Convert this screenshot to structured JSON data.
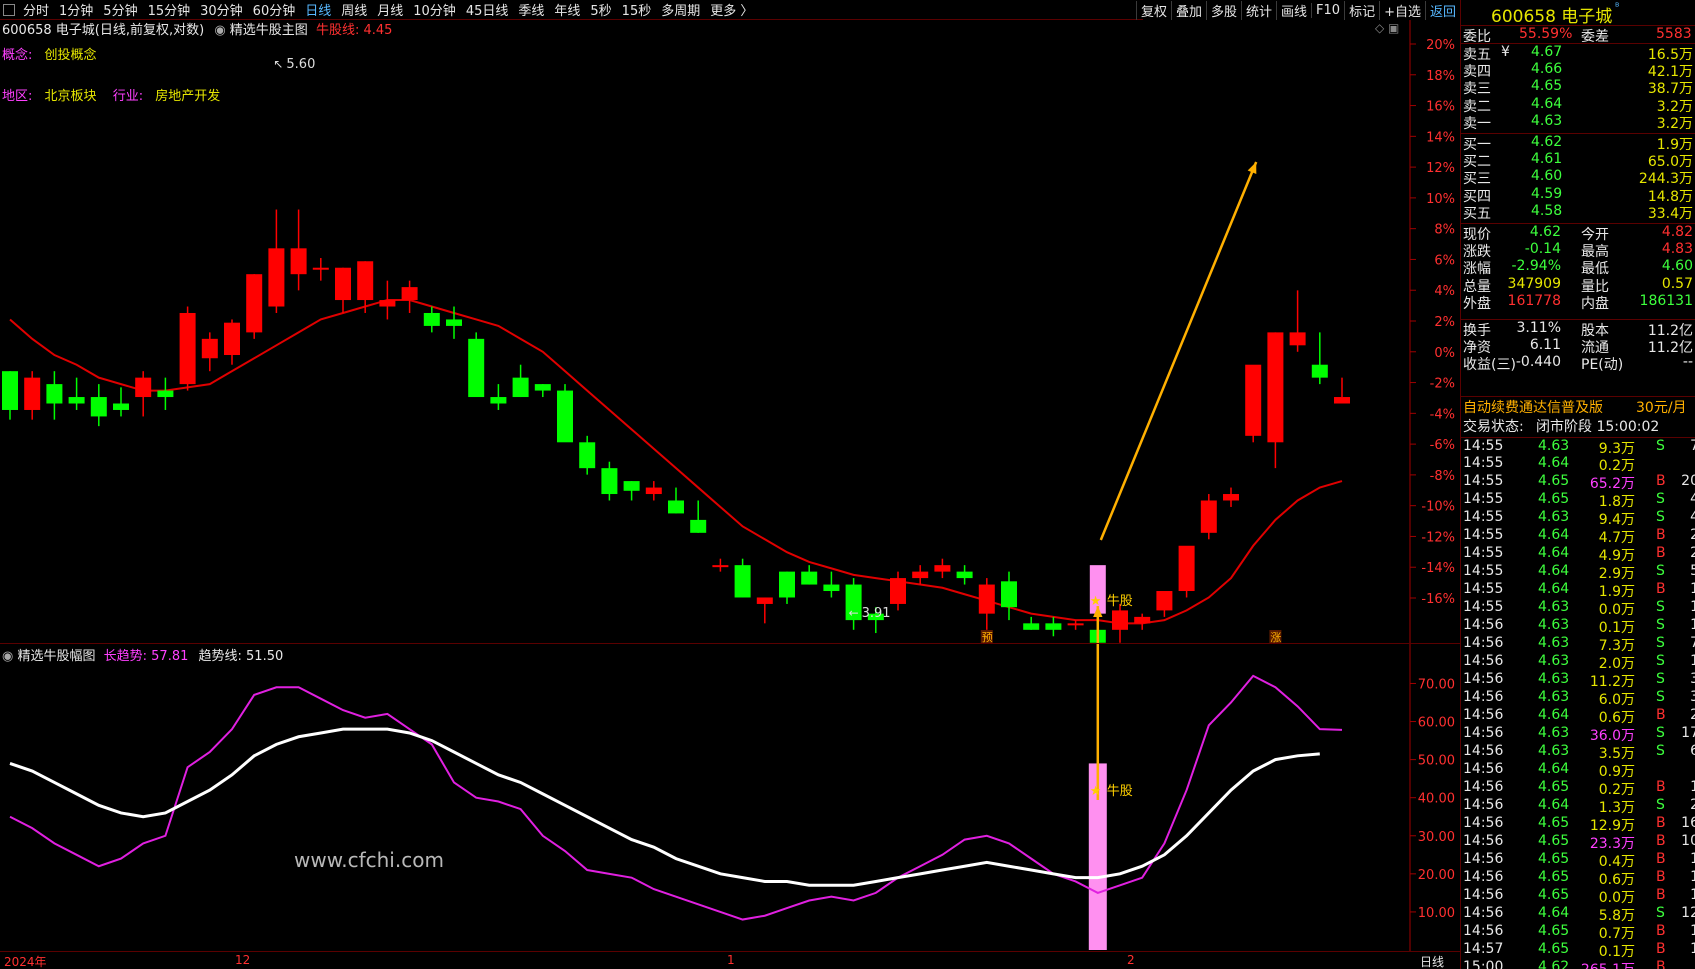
{
  "toolbar": {
    "periods": [
      "分时",
      "1分钟",
      "5分钟",
      "15分钟",
      "30分钟",
      "60分钟",
      "日线",
      "周线",
      "月线",
      "10分钟",
      "45日线",
      "季线",
      "年线",
      "5秒",
      "15秒",
      "多周期",
      "更多 〉"
    ],
    "active": "日线",
    "right": [
      "复权",
      "叠加",
      "多股",
      "统计",
      "画线",
      "F10",
      "标记",
      "+自选",
      "返回"
    ]
  },
  "main_header": {
    "stock": "600658 电子城(日线,前复权,对数)",
    "indicator": "精选牛股主图",
    "niu_line": "牛股线: 4.45"
  },
  "concept": {
    "label": "概念:",
    "value": "创投概念"
  },
  "region": {
    "label": "地区:",
    "value": "北京板块",
    "industry_label": "行业:",
    "industry_value": "房地产开发"
  },
  "price_labels": {
    "high": "5.60",
    "low": "3.91",
    "niu1": "牛股",
    "niu2": "牛股",
    "mark_yu": "预",
    "mark_zhang": "涨"
  },
  "y_axis_main": [
    "20%",
    "18%",
    "16%",
    "14%",
    "12%",
    "10%",
    "8%",
    "6%",
    "4%",
    "2%",
    "0%",
    "-2%",
    "-4%",
    "-6%",
    "-8%",
    "-10%",
    "-12%",
    "-14%",
    "-16%"
  ],
  "sub_header": {
    "name": "精选牛股幅图",
    "long_trend": "长趋势: 57.81",
    "trend_line": "趋势线: 51.50"
  },
  "y_axis_sub": [
    "70.00",
    "60.00",
    "50.00",
    "40.00",
    "30.00",
    "20.00",
    "10.00"
  ],
  "watermark": "www.cfchi.com",
  "x_axis": {
    "labels": [
      "2024年",
      "12",
      "1",
      "2"
    ],
    "period": "日线"
  },
  "colors": {
    "up": "#ff0000",
    "down": "#00ff00",
    "ma": "#e00000",
    "long_trend": "#e020e0",
    "trend": "#ffffff",
    "niu_bar": "#ff90f0",
    "arrow": "#ffb000"
  },
  "chart_data": {
    "type": "candlestick",
    "candles": [
      [
        4.7,
        4.7,
        4.55,
        4.58
      ],
      [
        4.58,
        4.7,
        4.55,
        4.68
      ],
      [
        4.66,
        4.7,
        4.55,
        4.6
      ],
      [
        4.62,
        4.68,
        4.58,
        4.6
      ],
      [
        4.62,
        4.66,
        4.53,
        4.56
      ],
      [
        4.6,
        4.65,
        4.56,
        4.58
      ],
      [
        4.62,
        4.7,
        4.56,
        4.68
      ],
      [
        4.64,
        4.68,
        4.58,
        4.62
      ],
      [
        4.66,
        4.9,
        4.64,
        4.88
      ],
      [
        4.74,
        4.82,
        4.7,
        4.8
      ],
      [
        4.75,
        4.86,
        4.72,
        4.85
      ],
      [
        4.82,
        5.0,
        4.8,
        5.0
      ],
      [
        4.9,
        5.2,
        4.88,
        5.08
      ],
      [
        5.0,
        5.2,
        4.95,
        5.08
      ],
      [
        5.02,
        5.05,
        4.98,
        5.02
      ],
      [
        4.92,
        5.02,
        4.88,
        5.02
      ],
      [
        4.92,
        5.04,
        4.88,
        5.04
      ],
      [
        4.9,
        4.98,
        4.86,
        4.92
      ],
      [
        4.92,
        4.98,
        4.88,
        4.96
      ],
      [
        4.88,
        4.9,
        4.82,
        4.84
      ],
      [
        4.86,
        4.9,
        4.8,
        4.84
      ],
      [
        4.8,
        4.82,
        4.64,
        4.62
      ],
      [
        4.62,
        4.66,
        4.58,
        4.6
      ],
      [
        4.68,
        4.72,
        4.62,
        4.62
      ],
      [
        4.66,
        4.66,
        4.62,
        4.64
      ],
      [
        4.64,
        4.66,
        4.5,
        4.48
      ],
      [
        4.48,
        4.5,
        4.38,
        4.4
      ],
      [
        4.4,
        4.42,
        4.3,
        4.32
      ],
      [
        4.36,
        4.36,
        4.3,
        4.33
      ],
      [
        4.32,
        4.36,
        4.3,
        4.34
      ],
      [
        4.3,
        4.34,
        4.26,
        4.26
      ],
      [
        4.24,
        4.3,
        4.2,
        4.2
      ],
      [
        4.1,
        4.12,
        4.08,
        4.1
      ],
      [
        4.1,
        4.12,
        4.0,
        4.0
      ],
      [
        3.98,
        4.0,
        3.92,
        4.0
      ],
      [
        4.08,
        4.08,
        3.98,
        4.0
      ],
      [
        4.08,
        4.1,
        4.04,
        4.04
      ],
      [
        4.04,
        4.08,
        4.0,
        4.02
      ],
      [
        4.04,
        4.06,
        3.9,
        3.93
      ],
      [
        3.95,
        3.97,
        3.89,
        3.93
      ],
      [
        3.98,
        4.08,
        3.96,
        4.06
      ],
      [
        4.06,
        4.1,
        4.04,
        4.08
      ],
      [
        4.08,
        4.12,
        4.06,
        4.1
      ],
      [
        4.08,
        4.1,
        4.04,
        4.06
      ],
      [
        3.95,
        4.06,
        3.9,
        4.04
      ],
      [
        4.05,
        4.08,
        3.93,
        3.97
      ],
      [
        3.92,
        3.94,
        3.9,
        3.9
      ],
      [
        3.92,
        3.94,
        3.88,
        3.9
      ],
      [
        3.92,
        3.93,
        3.9,
        3.92
      ],
      [
        3.9,
        3.92,
        3.84,
        3.86
      ],
      [
        3.9,
        3.98,
        3.86,
        3.96
      ],
      [
        3.92,
        3.95,
        3.9,
        3.94
      ],
      [
        3.96,
        4.0,
        3.94,
        4.02
      ],
      [
        4.02,
        4.14,
        4.0,
        4.16
      ],
      [
        4.2,
        4.32,
        4.18,
        4.3
      ],
      [
        4.3,
        4.34,
        4.28,
        4.32
      ],
      [
        4.5,
        4.6,
        4.48,
        4.72
      ],
      [
        4.48,
        4.82,
        4.4,
        4.82
      ],
      [
        4.78,
        4.95,
        4.76,
        4.82
      ],
      [
        4.72,
        4.82,
        4.66,
        4.68
      ],
      [
        4.6,
        4.68,
        4.62,
        4.62
      ]
    ],
    "ma": [
      4.86,
      4.8,
      4.75,
      4.72,
      4.68,
      4.66,
      4.64,
      4.64,
      4.65,
      4.66,
      4.7,
      4.74,
      4.78,
      4.82,
      4.86,
      4.88,
      4.9,
      4.92,
      4.92,
      4.9,
      4.88,
      4.86,
      4.84,
      4.8,
      4.76,
      4.7,
      4.64,
      4.58,
      4.52,
      4.46,
      4.4,
      4.34,
      4.28,
      4.22,
      4.18,
      4.14,
      4.11,
      4.09,
      4.07,
      4.06,
      4.05,
      4.04,
      4.03,
      4.01,
      3.99,
      3.97,
      3.95,
      3.94,
      3.93,
      3.93,
      3.92,
      3.92,
      3.93,
      3.96,
      4.0,
      4.06,
      4.16,
      4.24,
      4.3,
      4.34,
      4.36
    ],
    "long_trend": [
      35,
      32,
      28,
      25,
      22,
      24,
      28,
      30,
      48,
      52,
      58,
      67,
      69,
      69,
      66,
      63,
      61,
      62,
      58,
      54,
      44,
      40,
      39,
      37,
      30,
      26,
      21,
      20,
      19,
      16,
      14,
      12,
      10,
      8,
      9,
      11,
      13,
      14,
      13,
      15,
      19,
      22,
      25,
      29,
      30,
      28,
      24,
      20,
      18,
      15,
      17,
      19,
      28,
      42,
      59,
      65,
      72,
      69,
      64,
      58,
      57.81
    ],
    "trend_line": [
      49,
      47,
      44,
      41,
      38,
      36,
      35,
      36,
      39,
      42,
      46,
      51,
      54,
      56,
      57,
      58,
      58,
      58,
      57,
      55,
      52,
      49,
      46,
      44,
      41,
      38,
      35,
      32,
      29,
      27,
      24,
      22,
      20,
      19,
      18,
      18,
      17,
      17,
      17,
      18,
      19,
      20,
      21,
      22,
      23,
      22,
      21,
      20,
      19,
      19,
      20,
      22,
      25,
      30,
      36,
      42,
      47,
      50,
      51,
      51.5
    ]
  },
  "side": {
    "code_name": "600658 电子城",
    "webi": {
      "label": "委比",
      "value": "55.59%",
      "label2": "委差",
      "value2": "5583"
    },
    "sells": [
      {
        "label": "卖五",
        "flag": "¥",
        "price": "4.67",
        "vol": "16.5万"
      },
      {
        "label": "卖四",
        "flag": "",
        "price": "4.66",
        "vol": "42.1万"
      },
      {
        "label": "卖三",
        "flag": "",
        "price": "4.65",
        "vol": "38.7万"
      },
      {
        "label": "卖二",
        "flag": "",
        "price": "4.64",
        "vol": "3.2万"
      },
      {
        "label": "卖一",
        "flag": "",
        "price": "4.63",
        "vol": "3.2万"
      }
    ],
    "buys": [
      {
        "label": "买一",
        "price": "4.62",
        "vol": "1.9万"
      },
      {
        "label": "买二",
        "price": "4.61",
        "vol": "65.0万"
      },
      {
        "label": "买三",
        "price": "4.60",
        "vol": "244.3万"
      },
      {
        "label": "买四",
        "price": "4.59",
        "vol": "14.8万"
      },
      {
        "label": "买五",
        "price": "4.58",
        "vol": "33.4万"
      }
    ],
    "stats": [
      {
        "l": "现价",
        "v": "4.62",
        "vc": "green",
        "l2": "今开",
        "v2": "4.82",
        "v2c": "red"
      },
      {
        "l": "涨跌",
        "v": "-0.14",
        "vc": "green",
        "l2": "最高",
        "v2": "4.83",
        "v2c": "red"
      },
      {
        "l": "涨幅",
        "v": "-2.94%",
        "vc": "green",
        "l2": "最低",
        "v2": "4.60",
        "v2c": "green"
      },
      {
        "l": "总量",
        "v": "347909",
        "vc": "yellow",
        "l2": "量比",
        "v2": "0.57",
        "v2c": "yellow"
      },
      {
        "l": "外盘",
        "v": "161778",
        "vc": "red",
        "l2": "内盘",
        "v2": "186131",
        "v2c": "green"
      }
    ],
    "stats2": [
      {
        "l": "换手",
        "v": "3.11%",
        "l2": "股本",
        "v2": "11.2亿"
      },
      {
        "l": "净资",
        "v": "6.11",
        "l2": "流通",
        "v2": "11.2亿"
      },
      {
        "l": "收益(三)",
        "v": "-0.440",
        "l2": "PE(动)",
        "v2": "--"
      }
    ],
    "promo": {
      "text": "自动续费通达信普及版",
      "price": "30元/月"
    },
    "trade_status": {
      "label": "交易状态:",
      "value": "闭市阶段 15:00:02"
    },
    "ticks": [
      [
        "14:55",
        "4.63",
        "9.3万",
        "S",
        "7"
      ],
      [
        "14:55",
        "4.64",
        "0.2万",
        "",
        ""
      ],
      [
        "14:55",
        "4.65",
        "65.2万",
        "B",
        "20"
      ],
      [
        "14:55",
        "4.65",
        "1.8万",
        "S",
        "4"
      ],
      [
        "14:55",
        "4.63",
        "9.4万",
        "S",
        "4"
      ],
      [
        "14:55",
        "4.64",
        "4.7万",
        "B",
        "2"
      ],
      [
        "14:55",
        "4.64",
        "4.9万",
        "B",
        "2"
      ],
      [
        "14:55",
        "4.64",
        "2.9万",
        "S",
        "5"
      ],
      [
        "14:55",
        "4.64",
        "1.9万",
        "B",
        "1"
      ],
      [
        "14:55",
        "4.63",
        "0.0万",
        "S",
        "1"
      ],
      [
        "14:56",
        "4.63",
        "0.1万",
        "S",
        "1"
      ],
      [
        "14:56",
        "4.63",
        "7.3万",
        "S",
        "7"
      ],
      [
        "14:56",
        "4.63",
        "2.0万",
        "S",
        "1"
      ],
      [
        "14:56",
        "4.63",
        "11.2万",
        "S",
        "3"
      ],
      [
        "14:56",
        "4.63",
        "6.0万",
        "S",
        "3"
      ],
      [
        "14:56",
        "4.64",
        "0.6万",
        "B",
        "2"
      ],
      [
        "14:56",
        "4.63",
        "36.0万",
        "S",
        "17"
      ],
      [
        "14:56",
        "4.63",
        "3.5万",
        "S",
        "6"
      ],
      [
        "14:56",
        "4.64",
        "0.9万",
        "",
        ""
      ],
      [
        "14:56",
        "4.65",
        "0.2万",
        "B",
        "1"
      ],
      [
        "14:56",
        "4.64",
        "1.3万",
        "S",
        "2"
      ],
      [
        "14:56",
        "4.65",
        "12.9万",
        "B",
        "16"
      ],
      [
        "14:56",
        "4.65",
        "23.3万",
        "B",
        "10"
      ],
      [
        "14:56",
        "4.65",
        "0.4万",
        "B",
        "1"
      ],
      [
        "14:56",
        "4.65",
        "0.6万",
        "B",
        "1"
      ],
      [
        "14:56",
        "4.65",
        "0.0万",
        "B",
        "1"
      ],
      [
        "14:56",
        "4.64",
        "5.8万",
        "S",
        "12"
      ],
      [
        "14:56",
        "4.65",
        "0.7万",
        "B",
        "1"
      ],
      [
        "14:57",
        "4.65",
        "0.1万",
        "B",
        "1"
      ],
      [
        "15:00",
        "4.62",
        "265.1万",
        "B",
        ""
      ]
    ]
  }
}
